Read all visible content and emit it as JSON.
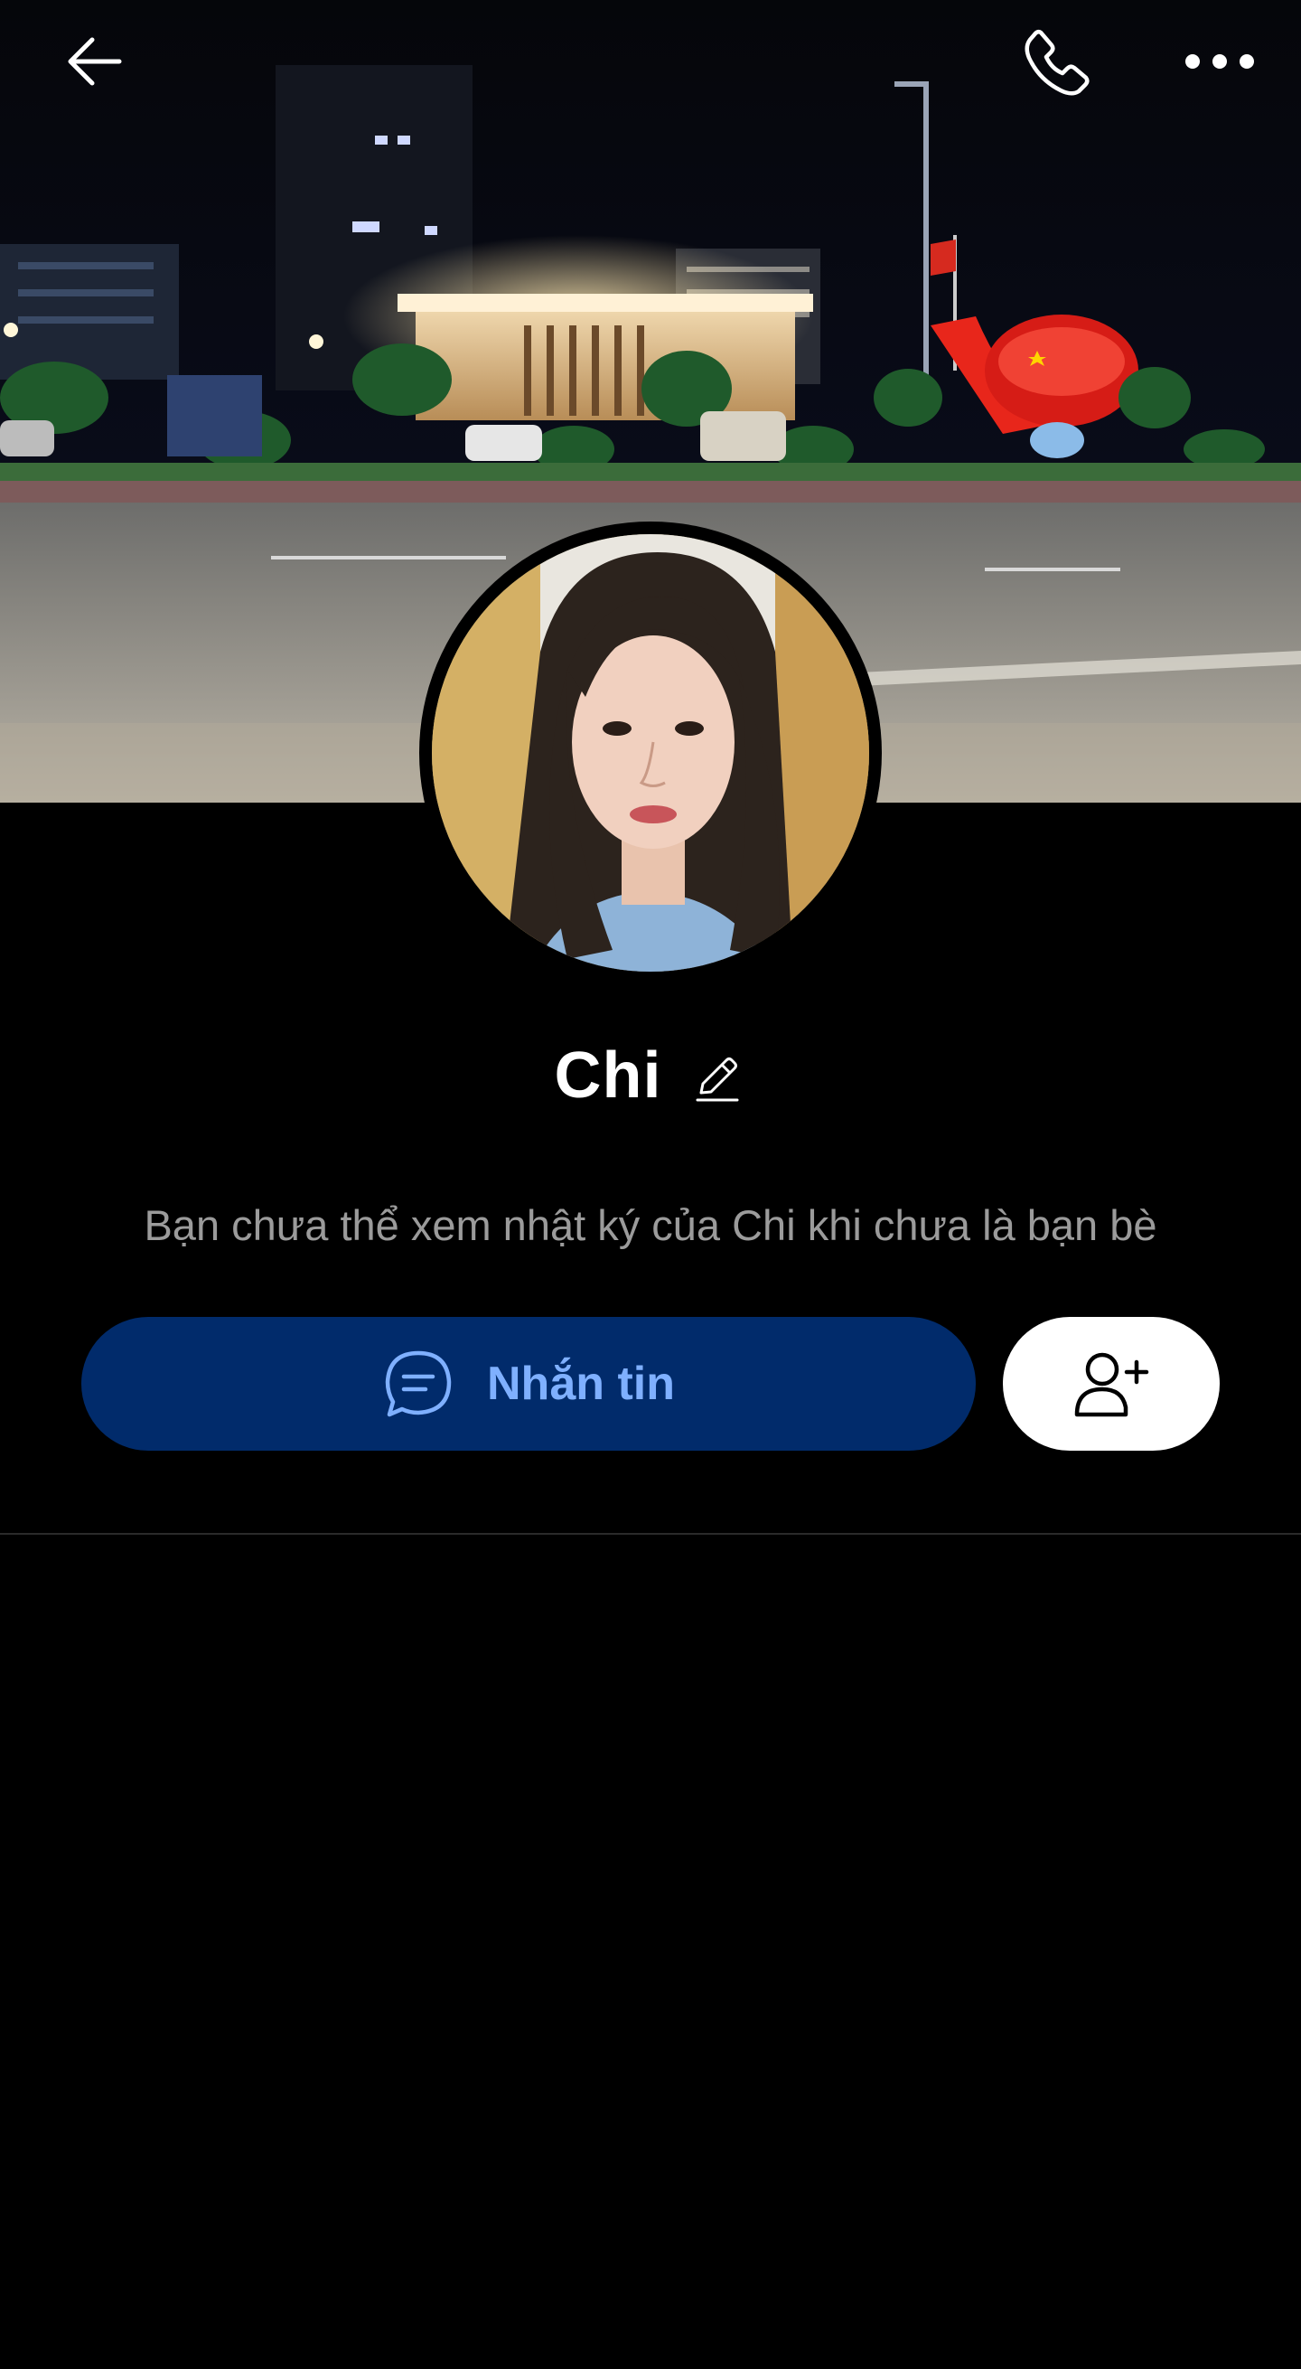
{
  "profile": {
    "name": "Chi",
    "notice": "Bạn chưa thể xem nhật ký của Chi khi chưa là bạn bè"
  },
  "actions": {
    "message_label": "Nhắn tin"
  },
  "icons": {
    "back": "arrow-left-icon",
    "call": "phone-icon",
    "more": "more-dots-icon",
    "edit": "pencil-icon",
    "message": "chat-bubble-icon",
    "add_friend": "user-plus-icon"
  },
  "colors": {
    "background": "#000000",
    "message_button": "#012b6b",
    "message_text": "#7fb0ff",
    "add_friend_button": "#ffffff",
    "notice_text": "#9b9b9b"
  }
}
